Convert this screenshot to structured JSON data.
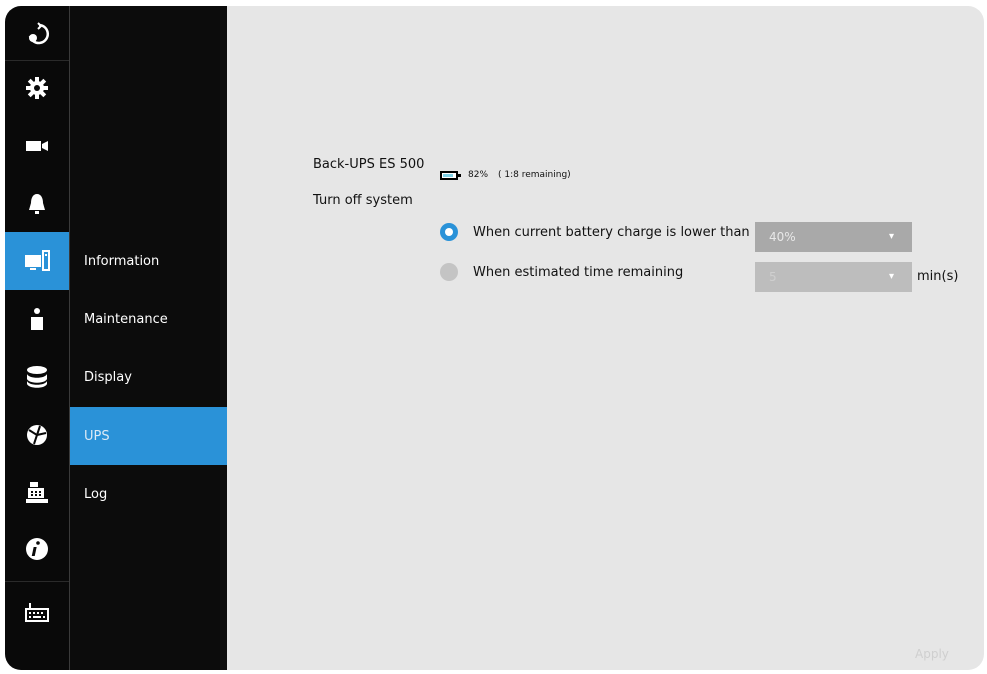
{
  "nav_icons": [
    {
      "name": "back-icon",
      "active": false
    },
    {
      "name": "settings-gear-icon",
      "active": false
    },
    {
      "name": "camera-icon",
      "active": false
    },
    {
      "name": "alarm-bell-icon",
      "active": false
    },
    {
      "name": "system-computer-icon",
      "active": true
    },
    {
      "name": "user-icon",
      "active": false
    },
    {
      "name": "storage-icon",
      "active": false
    },
    {
      "name": "network-globe-icon",
      "active": false
    },
    {
      "name": "pos-register-icon",
      "active": false
    },
    {
      "name": "info-icon",
      "active": false
    },
    {
      "name": "keyboard-icon",
      "active": false
    }
  ],
  "submenu": {
    "items": [
      {
        "label": "Information",
        "active": false
      },
      {
        "label": "Maintenance",
        "active": false
      },
      {
        "label": "Display",
        "active": false
      },
      {
        "label": "UPS",
        "active": true
      },
      {
        "label": "Log",
        "active": false
      }
    ]
  },
  "ups": {
    "device_name": "Back-UPS ES 500",
    "battery_percent": "82%",
    "battery_remaining": "( 1:8 remaining)",
    "battery_level": 0.82,
    "turn_off_label": "Turn off system",
    "option1_label": "When current battery charge is lower than",
    "option1_selected": true,
    "option1_value": "40%",
    "option2_label": "When estimated time remaining",
    "option2_selected": false,
    "option2_value": "5",
    "option2_unit": "min(s)"
  },
  "apply_label": "Apply",
  "colors": {
    "accent": "#2a92d8",
    "sidebar": "#090909",
    "content_bg": "#e6e6e6"
  }
}
